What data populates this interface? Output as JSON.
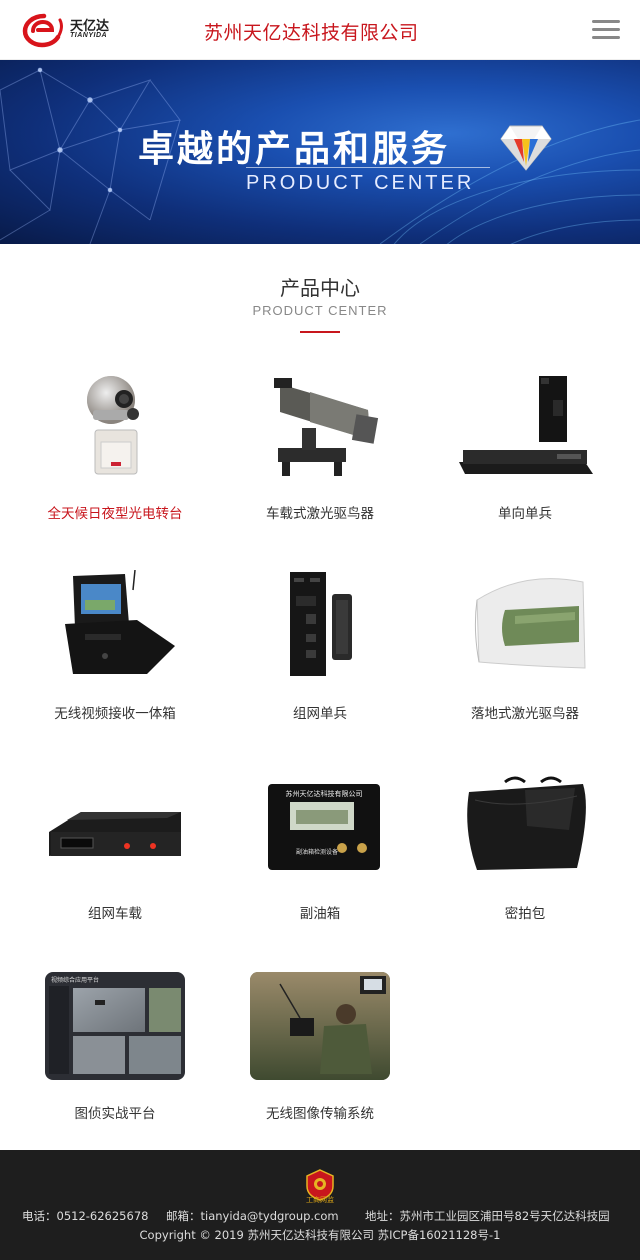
{
  "header": {
    "logo_cn": "天亿达",
    "logo_en": "TIANYIDA",
    "company_name": "苏州天亿达科技有限公司",
    "menu_icon": "hamburger-menu-icon"
  },
  "banner": {
    "title": "卓越的产品和服务",
    "subtitle": "PRODUCT CENTER"
  },
  "section": {
    "title": "产品中心",
    "subtitle": "PRODUCT CENTER",
    "accent_color": "#c8161d"
  },
  "products": [
    {
      "name": "全天候日夜型光电转台",
      "active": true
    },
    {
      "name": "车载式激光驱鸟器"
    },
    {
      "name": "单向单兵"
    },
    {
      "name": "无线视频接收一体箱"
    },
    {
      "name": "组网单兵"
    },
    {
      "name": "落地式激光驱鸟器"
    },
    {
      "name": "组网车载"
    },
    {
      "name": "副油箱"
    },
    {
      "name": "密拍包"
    },
    {
      "name": "图侦实战平台"
    },
    {
      "name": "无线图像传输系统"
    }
  ],
  "product_images": {
    "fuel_box_label": "苏州天亿达科技有限公司",
    "fuel_box_caption": "副油箱检测设备",
    "platform_label": "视频综合应用平台"
  },
  "footer": {
    "badge_text": "工商网监",
    "phone": "电话：0512-62625678",
    "email": "邮箱：tianyida@tydgroup.com",
    "address": "地址：苏州市工业园区浦田号82号天亿达科技园",
    "copyright": "Copyright © 2019 苏州天亿达科技有限公司 苏ICP备16021128号-1"
  }
}
